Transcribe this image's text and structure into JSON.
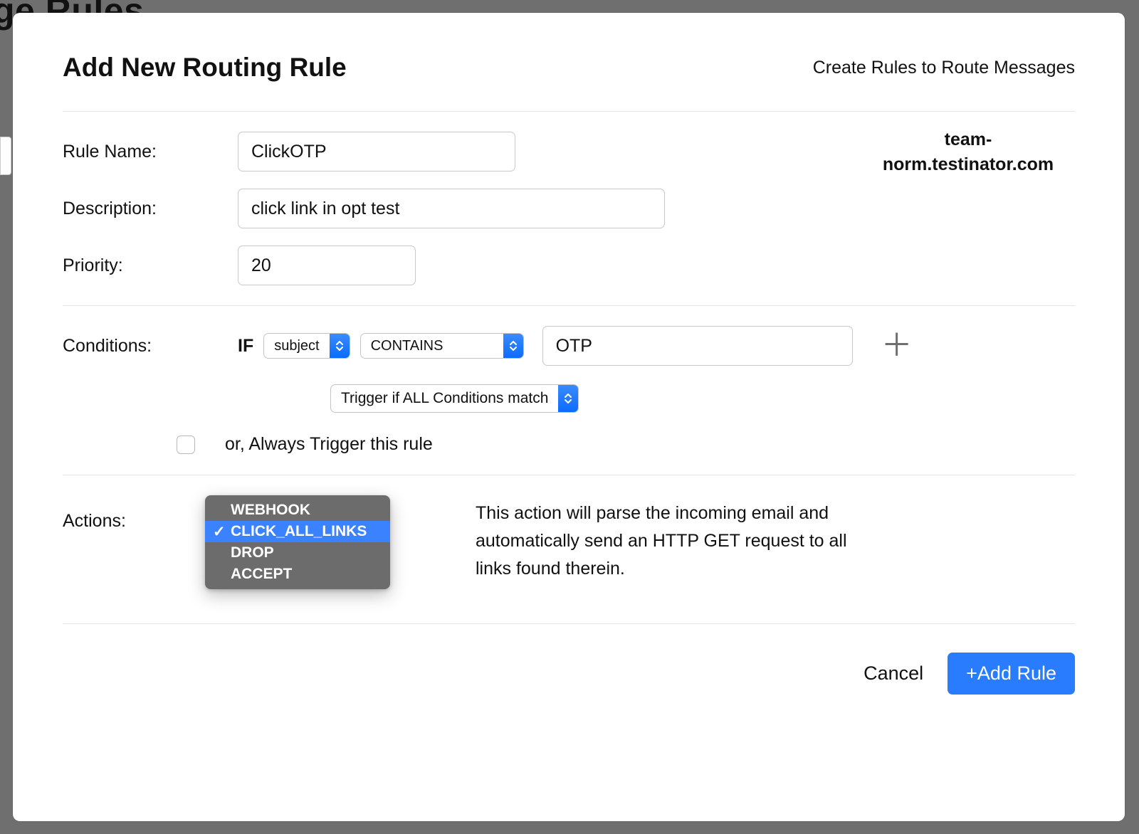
{
  "background": {
    "page_title": "ge Rules"
  },
  "modal": {
    "title": "Add New Routing Rule",
    "subtitle": "Create Rules to Route Messages",
    "domain": "team-norm.testinator.com",
    "labels": {
      "rule_name": "Rule Name:",
      "description": "Description:",
      "priority": "Priority:",
      "conditions": "Conditions:",
      "actions": "Actions:",
      "if": "IF"
    },
    "fields": {
      "rule_name": "ClickOTP",
      "description": "click link in opt test",
      "priority": "20"
    },
    "condition": {
      "field_select": "subject",
      "operator_select": "CONTAINS",
      "value": "OTP",
      "trigger_mode": "Trigger if ALL Conditions match",
      "always_trigger_label": "or, Always Trigger this rule",
      "always_trigger_checked": false
    },
    "actions_dropdown": {
      "options": [
        "WEBHOOK",
        "CLICK_ALL_LINKS",
        "DROP",
        "ACCEPT"
      ],
      "selected": "CLICK_ALL_LINKS",
      "description": "This action will parse the incoming email and automatically send an HTTP GET request to all links found therein."
    },
    "footer": {
      "cancel": "Cancel",
      "submit": "+Add Rule"
    }
  }
}
